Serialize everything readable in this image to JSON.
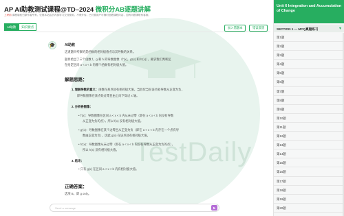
{
  "header": {
    "title_prefix": "AP AI助教测试课程@TD–2024 ",
    "title_highlight": "微积分AB逐题讲解",
    "warning_red": "上考前",
    "warning_rest": " 课程版权归原作者所有，仅限本站会员内部学习交流使用，不得外传。已付费用户可随时回看课程内容，如有问题请联系客服。",
    "tabs": [
      "AI助教",
      "知识要点"
    ],
    "active_tab": "AI助教",
    "add_button": "加入错题本",
    "report_button": "错误反馈"
  },
  "watermark": {
    "text": "TestDaily"
  },
  "chat": {
    "avatar_icon": "🎓",
    "bot_name": "AI助教",
    "intro1": "这道题目考察的是函数的相对极值点与其导数的关系。",
    "intro2": "题目给出了三个函数 f，g 和 h 的导数图像（f′(x)，g′(x) 和 h′(x)），要求我们判断区",
    "intro3": "在给定区间 a < x < b 内哪个函数有相对极大值。",
    "ideas_title": "解题思路：",
    "point1_title": "1. 理解导数的意义：",
    "point1_text": "函数在某点处有相对极大值，当且仅当在该点处导数从正变为负，",
    "point1_text2": "即导数图像在该点处过零且由上向下穿过 x 轴。",
    "point2_title": "2. 分析各图像：",
    "b1": "f′(x)：导数图像在区间 a < x < b 内从未过零（即在 a < x < b 内没有导数",
    "b1b": "从正变为负的点），所以 f(x) 没有相对极大值。",
    "b2": "g′(x)：导数图像在某个过零且从正变为负（即在 a < x < b 内存在一个点有导",
    "b2b": "数由正变为负），因此 g(x) 在该点处有相对极大值。",
    "b3": "h′(x)：导数图像从未过零（即在 a < x < b 内没有导数从正变为负的点），",
    "b3b": "所以 h(x) 没有相对极大值。",
    "point3_title": "3. 结论：",
    "b4": "只有 g(x) 在区间 a < x < b 内有相对极大值。",
    "answer_title": "正确答案：",
    "answer_text": "选项 B，即 g only。"
  },
  "input": {
    "placeholder": "Send a message",
    "send_icon": "send-icon"
  },
  "sidebar": {
    "unit_title": "Unit 6 Integration and Accumulation of Change",
    "section_label": "SECTION 1 — MCQ真题练习",
    "items": [
      "第1题",
      "第2题",
      "第3题",
      "第4题",
      "第5题",
      "第6题",
      "第7题",
      "第8题",
      "第9题",
      "第10题",
      "第11题",
      "第12题",
      "第13题",
      "第14题",
      "第15题",
      "第16题",
      "第17题",
      "第18题",
      "第19题",
      "第20题"
    ]
  },
  "colors": {
    "accent": "#27ae60",
    "send": "#b46cd6",
    "warning": "#e04a3f"
  }
}
